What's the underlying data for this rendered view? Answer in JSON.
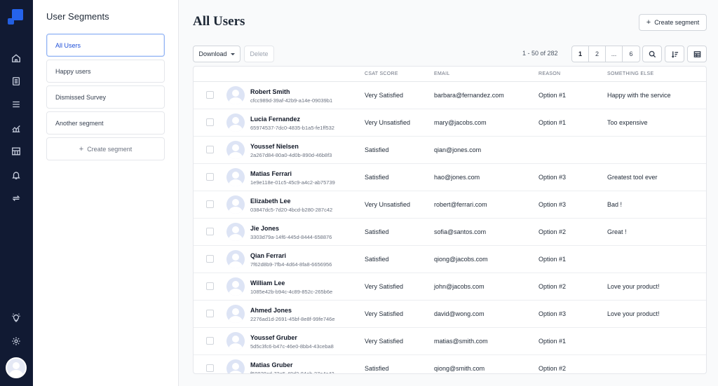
{
  "sidebar": {
    "icons": [
      "home-icon",
      "document-icon",
      "list-icon",
      "analytics-icon",
      "segments-icon",
      "bell-icon",
      "sync-icon",
      "lightbulb-icon",
      "gear-icon"
    ]
  },
  "segments": {
    "title": "User Segments",
    "items": [
      {
        "label": "All Users",
        "active": true
      },
      {
        "label": "Happy users",
        "active": false
      },
      {
        "label": "Dismissed Survey",
        "active": false
      },
      {
        "label": "Another segment",
        "active": false
      }
    ],
    "create_label": "Create segment"
  },
  "header": {
    "title": "All Users",
    "create_label": "Create segment"
  },
  "toolbar": {
    "download_label": "Download",
    "delete_label": "Delete",
    "range_label": "1 - 50 of 282",
    "pages": [
      "1",
      "2",
      "...",
      "6"
    ],
    "current_page": "1"
  },
  "table": {
    "columns": {
      "csat": "CSAT SCORE",
      "email": "EMAIL",
      "reason": "REASON",
      "else": "SOMETHING ELSE"
    },
    "rows": [
      {
        "name": "Robert Smith",
        "id": "cfcc989d-39af-42b9-a14e-09039b1",
        "csat": "Very Satisfied",
        "email": "barbara@fernandez.com",
        "reason": "Option #1",
        "else": "Happy with the service"
      },
      {
        "name": "Lucia Fernandez",
        "id": "65974537-7dc0-4835-b1a5-fe1ff532",
        "csat": "Very Unsatisfied",
        "email": "mary@jacobs.com",
        "reason": "Option #1",
        "else": "Too expensive"
      },
      {
        "name": "Youssef Nielsen",
        "id": "2a267d84-80a0-4d0b-890d-46b8f3",
        "csat": "Satisfied",
        "email": "qian@jones.com",
        "reason": "",
        "else": ""
      },
      {
        "name": "Matias Ferrari",
        "id": "1e9e118e-01c5-45c9-a4c2-ab75739",
        "csat": "Satisfied",
        "email": "hao@jones.com",
        "reason": "Option #3",
        "else": "Greatest tool ever"
      },
      {
        "name": "Elizabeth Lee",
        "id": "03847dc5-7d20-4bcd-b280-287c42",
        "csat": "Very Unsatisfied",
        "email": "robert@ferrari.com",
        "reason": "Option #3",
        "else": "Bad !"
      },
      {
        "name": "Jie Jones",
        "id": "3303d79a-14f6-445d-8444-658876",
        "csat": "Satisfied",
        "email": "sofia@santos.com",
        "reason": "Option #2",
        "else": "Great !"
      },
      {
        "name": "Qian Ferrari",
        "id": "7f62d8b9-7fb4-4d64-8fa8-6656956",
        "csat": "Satisfied",
        "email": "qiong@jacobs.com",
        "reason": "Option #1",
        "else": ""
      },
      {
        "name": "William Lee",
        "id": "1085e42b-b94c-4c89-852c-265b6e",
        "csat": "Very Satisfied",
        "email": "john@jacobs.com",
        "reason": "Option #2",
        "else": "Love your product!"
      },
      {
        "name": "Ahmed Jones",
        "id": "2276ad1d-2691-45bf-8e8f-99fe746e",
        "csat": "Very Satisfied",
        "email": "david@wong.com",
        "reason": "Option #3",
        "else": "Love your product!"
      },
      {
        "name": "Youssef Gruber",
        "id": "5d5c3fc6-b47c-46e0-8bb4-43ceba8",
        "csat": "Very Satisfied",
        "email": "matias@smith.com",
        "reason": "Option #1",
        "else": ""
      },
      {
        "name": "Matias Gruber",
        "id": "f50828cd-72a5-48d2-84ab-27a4c42",
        "csat": "Satisfied",
        "email": "qiong@smith.com",
        "reason": "Option #2",
        "else": ""
      }
    ]
  },
  "colors": {
    "rail": "#111a33",
    "accent": "#2563eb"
  }
}
